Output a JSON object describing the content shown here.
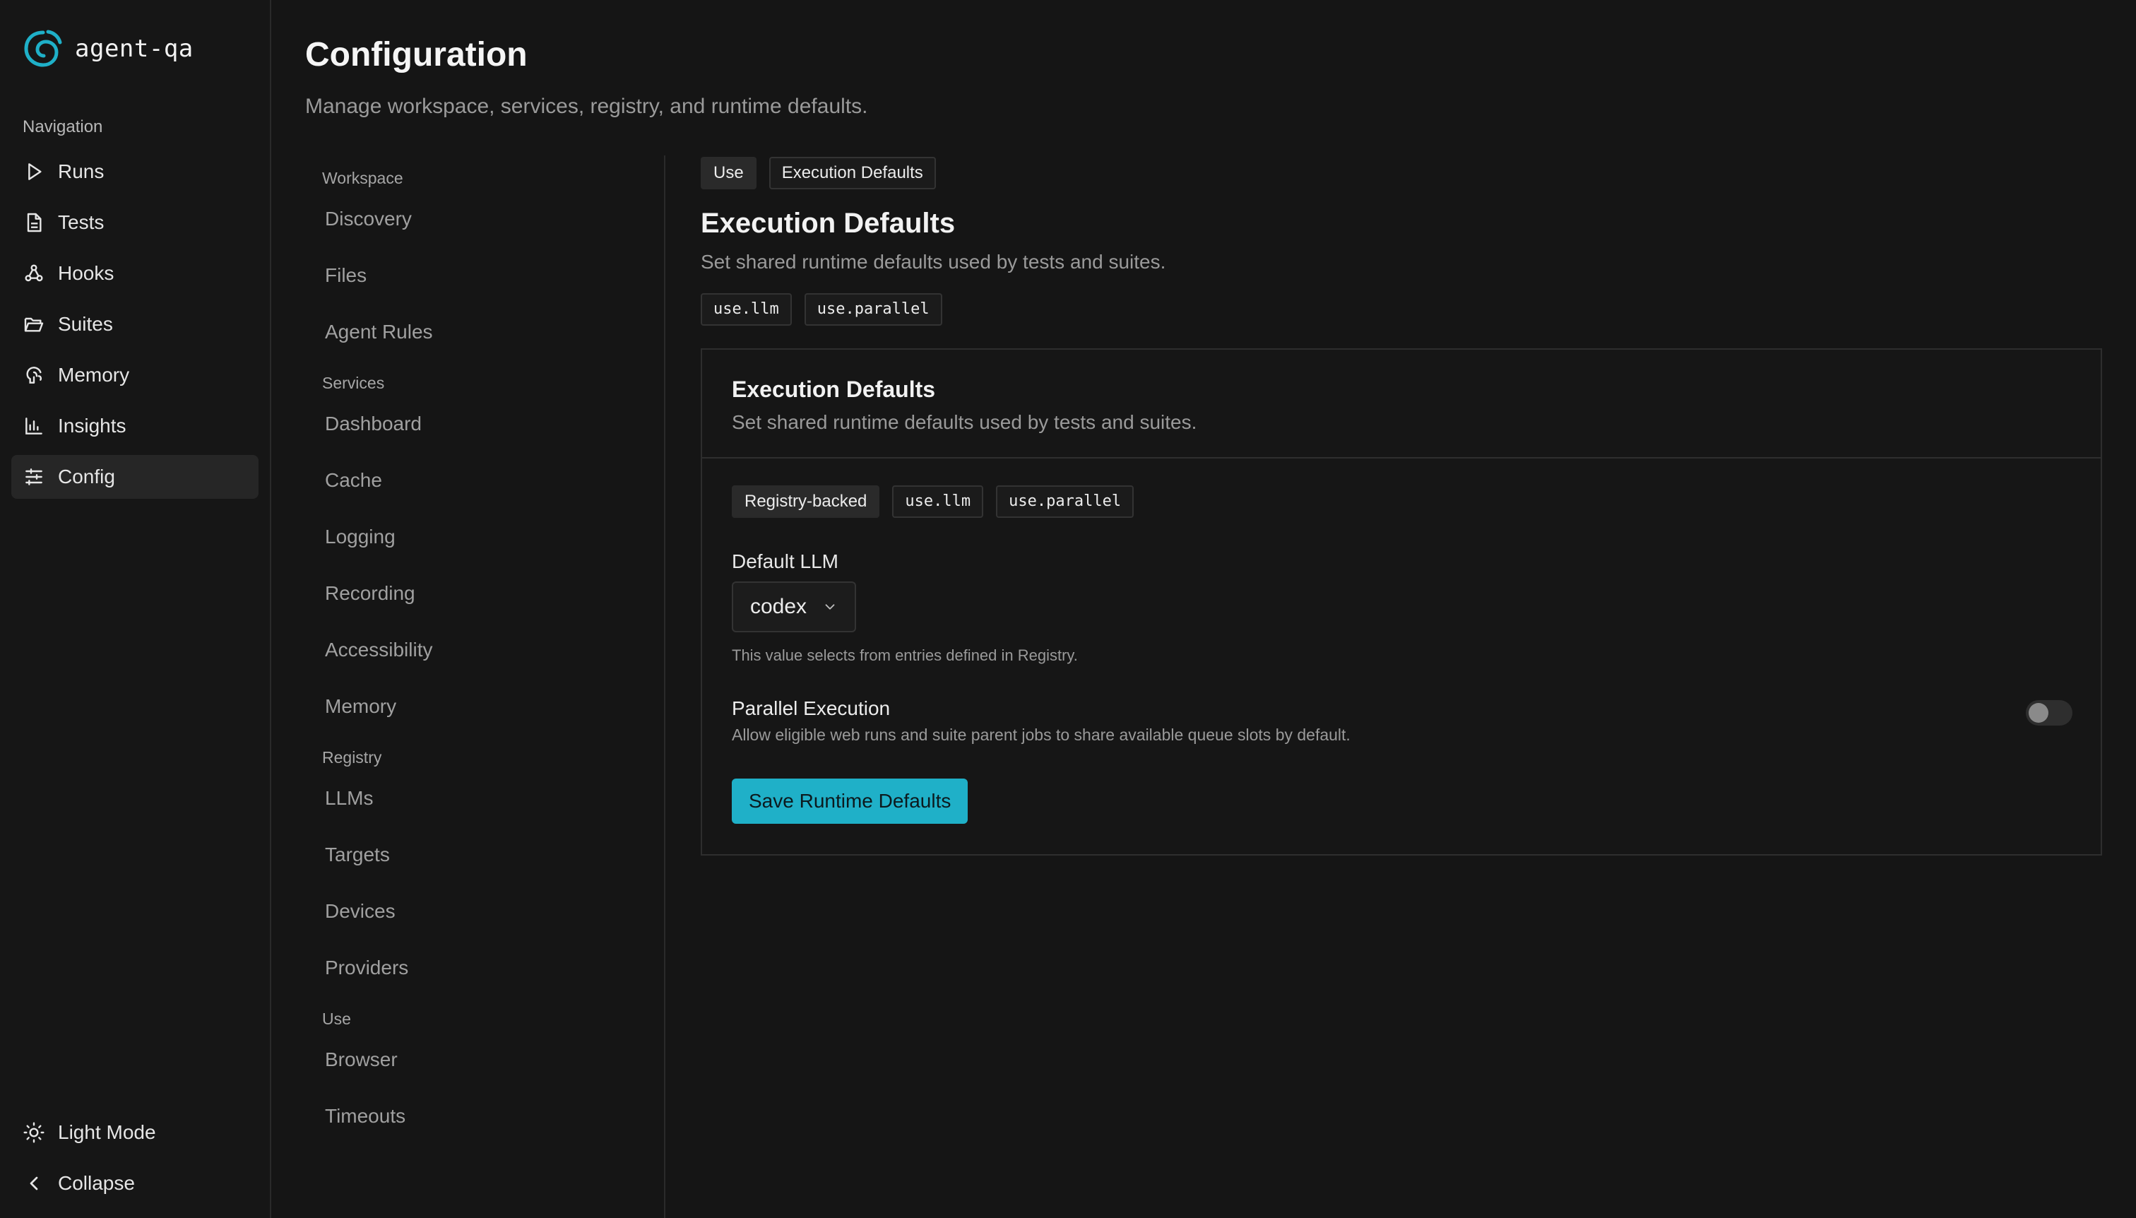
{
  "app": {
    "name": "agent-qa",
    "accent": "#1fb0c8"
  },
  "sidebar": {
    "heading": "Navigation",
    "items": [
      {
        "label": "Runs",
        "icon": "play-icon"
      },
      {
        "label": "Tests",
        "icon": "file-text-icon"
      },
      {
        "label": "Hooks",
        "icon": "webhook-icon"
      },
      {
        "label": "Suites",
        "icon": "folder-open-icon"
      },
      {
        "label": "Memory",
        "icon": "brain-icon"
      },
      {
        "label": "Insights",
        "icon": "bar-chart-icon"
      },
      {
        "label": "Config",
        "icon": "sliders-icon",
        "active": true
      }
    ],
    "bottom": [
      {
        "label": "Light Mode",
        "icon": "sun-icon"
      },
      {
        "label": "Collapse",
        "icon": "chevron-left-icon"
      }
    ]
  },
  "header": {
    "title": "Configuration",
    "subtitle": "Manage workspace, services, registry, and runtime defaults."
  },
  "config_nav": {
    "sections": [
      {
        "label": "Workspace",
        "items": [
          "Discovery",
          "Files",
          "Agent Rules"
        ]
      },
      {
        "label": "Services",
        "items": [
          "Dashboard",
          "Cache",
          "Logging",
          "Recording",
          "Accessibility",
          "Memory"
        ]
      },
      {
        "label": "Registry",
        "items": [
          "LLMs",
          "Targets",
          "Devices",
          "Providers"
        ]
      },
      {
        "label": "Use",
        "items": [
          "Browser",
          "Timeouts"
        ]
      }
    ]
  },
  "content": {
    "breadcrumb": [
      "Use",
      "Execution Defaults"
    ],
    "title": "Execution Defaults",
    "description": "Set shared runtime defaults used by tests and suites.",
    "keys": [
      "use.llm",
      "use.parallel"
    ],
    "card": {
      "title": "Execution Defaults",
      "description": "Set shared runtime defaults used by tests and suites.",
      "tags": [
        "Registry-backed",
        "use.llm",
        "use.parallel"
      ],
      "default_llm": {
        "label": "Default LLM",
        "value": "codex",
        "hint": "This value selects from entries defined in Registry."
      },
      "parallel": {
        "title": "Parallel Execution",
        "description": "Allow eligible web runs and suite parent jobs to share available queue slots by default.",
        "enabled": false
      },
      "save_label": "Save Runtime Defaults"
    }
  }
}
